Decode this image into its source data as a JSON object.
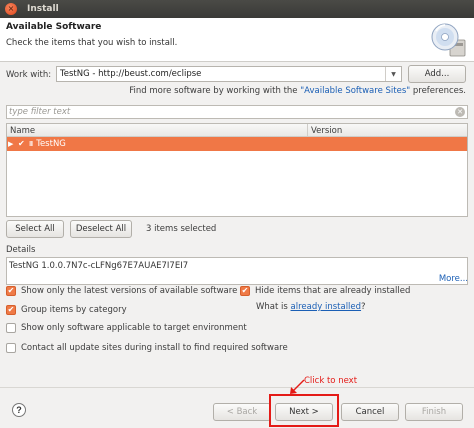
{
  "window": {
    "title": "Install",
    "close_glyph": "×"
  },
  "header": {
    "title": "Available Software",
    "description": "Check the items that you wish to install.",
    "icon": "cd-install-icon"
  },
  "work_with": {
    "label": "Work with:",
    "value": "TestNG - http://beust.com/eclipse",
    "add_label": "Add...",
    "find_more_prefix": "Find more software by working with the ",
    "find_more_link": "\"Available Software Sites\"",
    "find_more_suffix": " preferences."
  },
  "filter": {
    "placeholder": "type filter text"
  },
  "tree": {
    "columns": [
      "Name",
      "Version"
    ],
    "rows": [
      {
        "label": "TestNG",
        "icon": "III",
        "version": "",
        "checked": true,
        "selected": true
      }
    ]
  },
  "selection": {
    "select_all": "Select All",
    "deselect_all": "Deselect All",
    "count_text": "3 items selected"
  },
  "details": {
    "label": "Details",
    "text": "TestNG 1.0.0.7N7c-cLFNg67E7AUAE7I7EI7",
    "more_link": "More..."
  },
  "options": {
    "latest_versions": {
      "label": "Show only the latest versions of available software",
      "checked": true
    },
    "group_by_category": {
      "label": "Group items by category",
      "checked": true
    },
    "target_env": {
      "label": "Show only software applicable to target environment",
      "checked": false
    },
    "contact_sites": {
      "label": "Contact all update sites during install to find required software",
      "checked": false
    },
    "hide_installed": {
      "label": "Hide items that are already installed",
      "checked": true
    },
    "what_is_prefix": "What is ",
    "what_is_link": "already installed",
    "what_is_suffix": "?"
  },
  "footer": {
    "help_glyph": "?",
    "back": "< Back",
    "next": "Next >",
    "cancel": "Cancel",
    "finish": "Finish"
  },
  "annotation": {
    "text": "Click to next",
    "color": "#e41b17"
  },
  "colors": {
    "selection": "#f07746",
    "link": "#1b5fb5",
    "titlebar": "#3c3b37"
  }
}
